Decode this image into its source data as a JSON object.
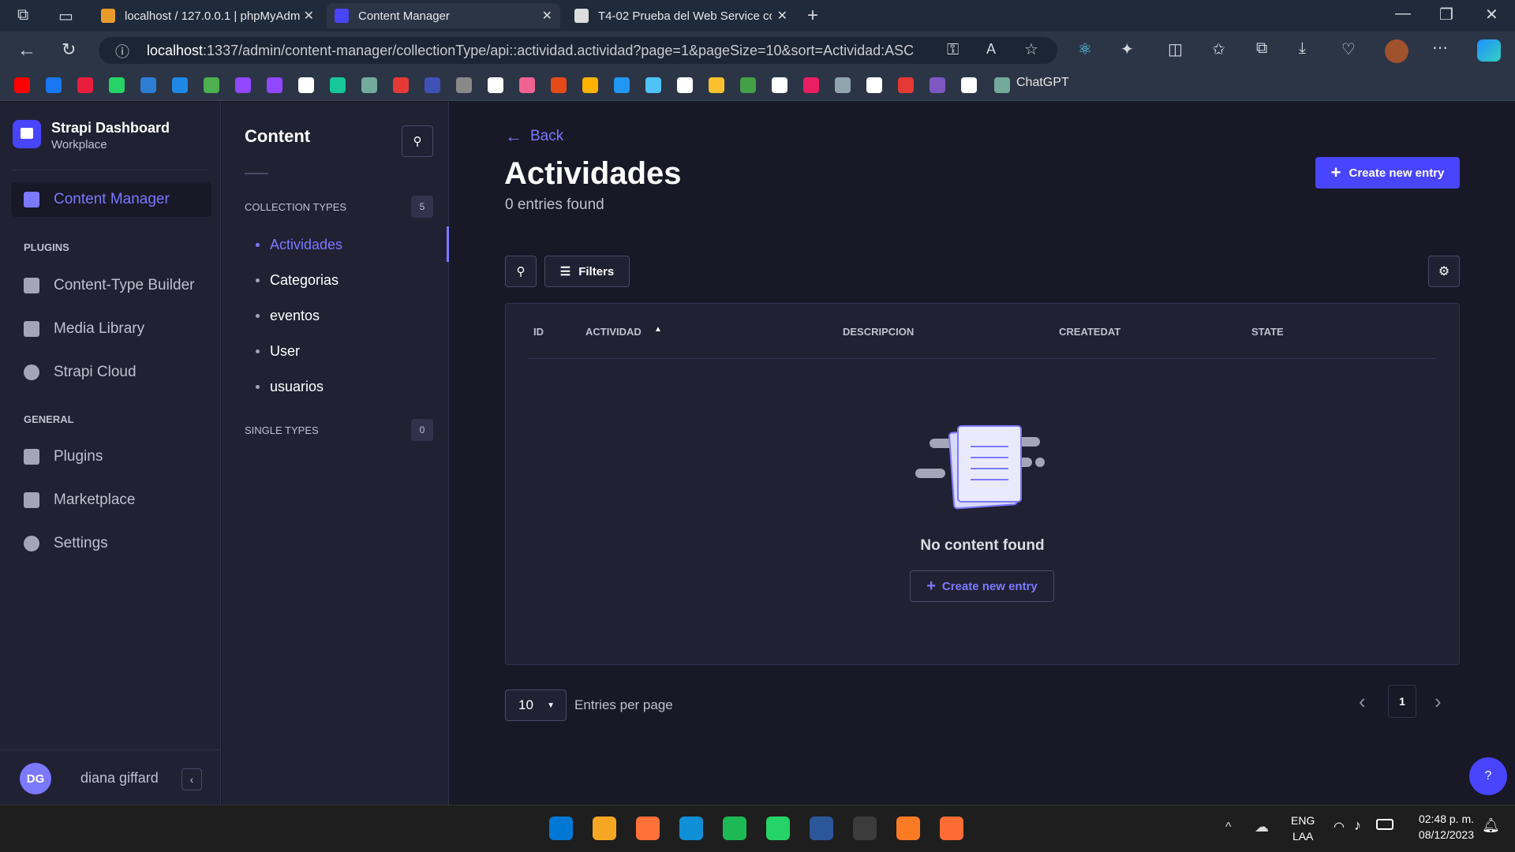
{
  "browser": {
    "tabs": [
      {
        "label": "localhost / 127.0.0.1 | phpMyAdm",
        "color": "#e89b2b"
      },
      {
        "label": "Content Manager",
        "color": "#4945ff"
      },
      {
        "label": "T4-02 Prueba del Web Service co",
        "color": "#dddddd"
      }
    ],
    "url_host": "localhost",
    "url_path": ":1337/admin/content-manager/collectionType/api::actividad.actividad?page=1&pageSize=10&sort=Actividad:ASC",
    "bookmark_label": "ChatGPT",
    "bookmark_colors": [
      "#ff0000",
      "#1877f2",
      "#e91e3c",
      "#25d366",
      "#2d7dd2",
      "#1e88e5",
      "#4caf50",
      "#9146ff",
      "#9146ff",
      "#ffffff",
      "#16c79a",
      "#74aa9c",
      "#e53935",
      "#3f51b5",
      "#888888",
      "#ffffff",
      "#f06292",
      "#e64a19",
      "#ffb300",
      "#2196f3",
      "#4fc3f7",
      "#ffffff",
      "#fbc02d",
      "#43a047",
      "#ffffff",
      "#e91e63",
      "#90a4ae",
      "#ffffff",
      "#e53935",
      "#7e57c2",
      "#ffffff"
    ]
  },
  "app": {
    "name": "Strapi Dashboard",
    "workspace": "Workplace"
  },
  "leftnav": {
    "active": "Content Manager",
    "plugins_label": "PLUGINS",
    "plugins": [
      "Content-Type Builder",
      "Media Library",
      "Strapi Cloud"
    ],
    "general_label": "GENERAL",
    "general": [
      "Plugins",
      "Marketplace",
      "Settings"
    ],
    "user_initials": "DG",
    "user_name": "diana giffard"
  },
  "subnav": {
    "title": "Content",
    "collection_label": "COLLECTION TYPES",
    "collection_count": "5",
    "collection_items": [
      "Actividades",
      "Categorias",
      "eventos",
      "User",
      "usuarios"
    ],
    "single_label": "SINGLE TYPES",
    "single_count": "0"
  },
  "main": {
    "back": "Back",
    "title": "Actividades",
    "subtitle": "0 entries found",
    "create_label": "Create new entry",
    "filters_label": "Filters",
    "columns": [
      "ID",
      "ACTIVIDAD",
      "DESCRIPCION",
      "CREATEDAT",
      "STATE"
    ],
    "empty_text": "No content found",
    "page_size": "10",
    "entries_label": "Entries per page",
    "current_page": "1",
    "help": "?"
  },
  "taskbar": {
    "lang1": "ENG",
    "lang2": "LAA",
    "time": "02:48 p. m.",
    "date": "08/12/2023",
    "app_colors": [
      "#0078d4",
      "#f5a623",
      "#ff7139",
      "#0f8fd6",
      "#1db954",
      "#25d366",
      "#2b579a",
      "#3c3c3c",
      "#fb7a24",
      "#ff6b35"
    ]
  },
  "colors": {
    "accent": "#4945ff",
    "accent_text": "#7b79ff",
    "bg": "#181826",
    "panel": "#212134"
  }
}
